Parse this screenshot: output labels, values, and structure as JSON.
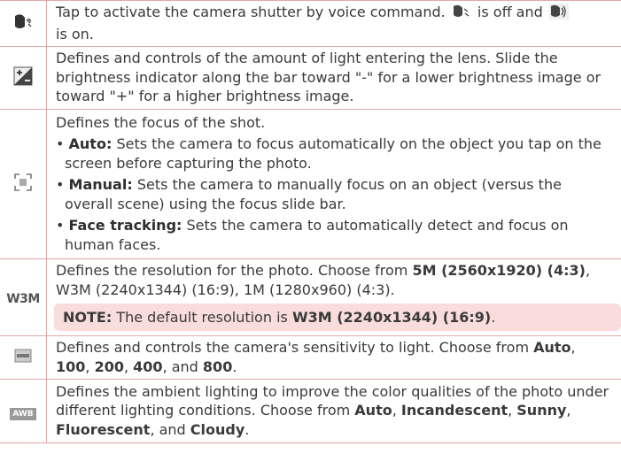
{
  "rows": [
    {
      "icon": "voice-shutter-icon",
      "text_a": "Tap to activate the camera shutter by voice command.",
      "text_b": "is off and",
      "text_c": "is on."
    },
    {
      "icon": "brightness-icon",
      "text": "Defines and controls of the amount of light entering the lens. Slide the brightness indicator along the bar toward \"-\" for a lower brightness image or toward \"+\" for a higher brightness image."
    },
    {
      "icon": "focus-icon",
      "intro": "Defines the focus of the shot.",
      "bullets": [
        {
          "label": "Auto:",
          "text": "Sets the camera to focus automatically on the object you tap on the screen before capturing the photo."
        },
        {
          "label": "Manual:",
          "text": "Sets the camera to manually focus on an object (versus the overall scene) using the focus slide bar."
        },
        {
          "label": "Face tracking:",
          "text": "Sets the camera to automatically detect and focus on human faces."
        }
      ]
    },
    {
      "icon_label": "W3M",
      "text_a": "Defines the resolution for the photo. Choose from",
      "opt1": "5M (2560x1920) (4:3)",
      "text_b": ", W3M (2240x1344) (16:9), 1M (1280x960) (4:3).",
      "note_label": "NOTE:",
      "note_text": "The default resolution is",
      "note_value": "W3M (2240x1344) (16:9)",
      "note_end": "."
    },
    {
      "icon": "iso-icon",
      "text_a": "Defines and controls the camera's sensitivity to light. Choose from",
      "opts": [
        "Auto",
        "100",
        "200",
        "400",
        "800"
      ],
      "sep": ", ",
      "and": ", and ",
      "end": "."
    },
    {
      "icon_label": "AWB",
      "text_a": "Defines the ambient lighting to improve the color qualities of the photo under different lighting conditions. Choose from",
      "opts": [
        "Auto",
        "Incandescent",
        "Sunny",
        "Fluorescent",
        "Cloudy"
      ],
      "sep": ", ",
      "and": ", and ",
      "end": "."
    }
  ],
  "colors": {
    "border": "#e0a8a8",
    "note_bg": "#f9dcdc",
    "text": "#3a3a3a"
  }
}
